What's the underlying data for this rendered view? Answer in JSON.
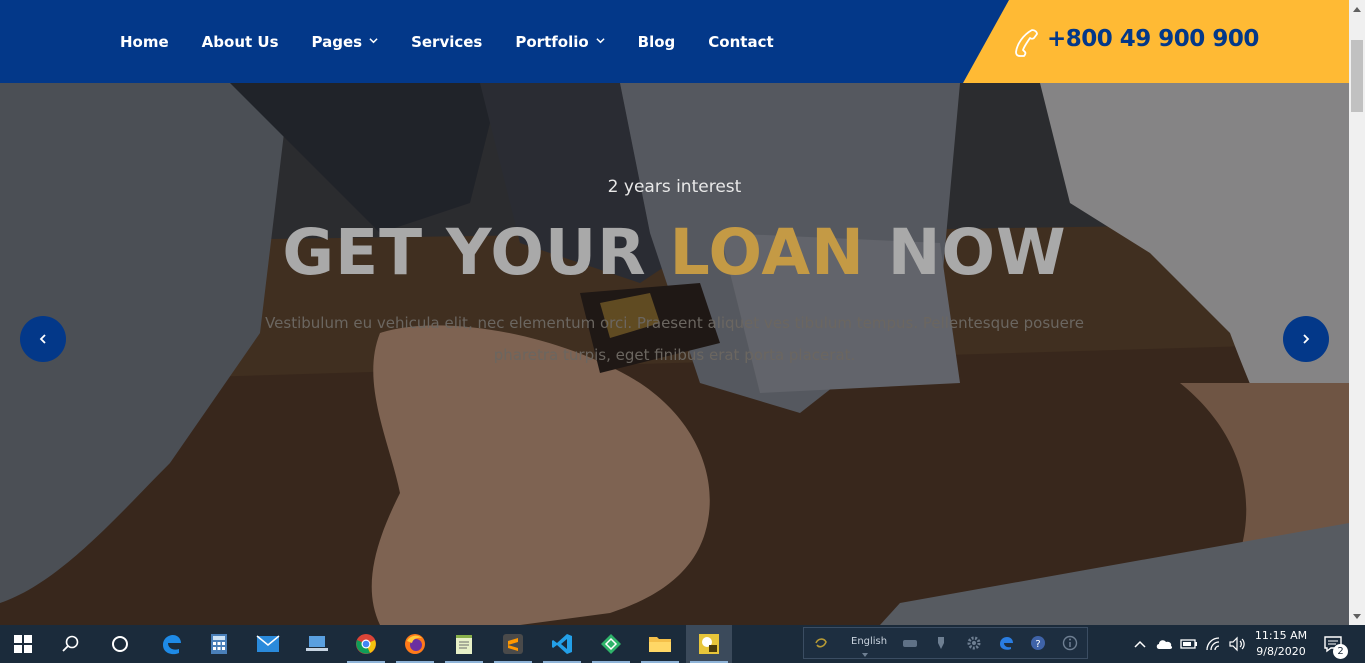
{
  "navbar": {
    "items": [
      {
        "label": "Home",
        "has_dropdown": false
      },
      {
        "label": "About Us",
        "has_dropdown": false
      },
      {
        "label": "Pages",
        "has_dropdown": true
      },
      {
        "label": "Services",
        "has_dropdown": false
      },
      {
        "label": "Portfolio",
        "has_dropdown": true
      },
      {
        "label": "Blog",
        "has_dropdown": false
      },
      {
        "label": "Contact",
        "has_dropdown": false
      }
    ],
    "phone": "+800 49 900 900",
    "phone_icon": "phone-icon"
  },
  "hero": {
    "subtitle": "2 years interest",
    "title_part1": "GET YOUR",
    "title_accent": "LOAN",
    "title_part2": "NOW",
    "description": "Vestibulum eu vehicula elit, nec elementum orci. Praesent aliquet ves tibulum tempus. Pellentesque posuere pharetra turpis, eget finibus erat porta placerat.",
    "prev_icon": "chevron-left-icon",
    "next_icon": "chevron-right-icon"
  },
  "taskbar": {
    "apps": [
      "start",
      "search",
      "cortana",
      "edge",
      "calculator",
      "mail",
      "file-share",
      "chrome",
      "firefox",
      "notepad",
      "sublime-text",
      "vscode",
      "app-green",
      "file-explorer",
      "app-yellow"
    ],
    "language": "English",
    "clock_time": "11:15 AM",
    "clock_date": "9/8/2020",
    "notification_count": "2"
  },
  "colors": {
    "nav_bg": "#033889",
    "accent_yellow": "#ffba34",
    "title_accent": "#c49a45",
    "taskbar_bg": "#1b2b3b"
  }
}
